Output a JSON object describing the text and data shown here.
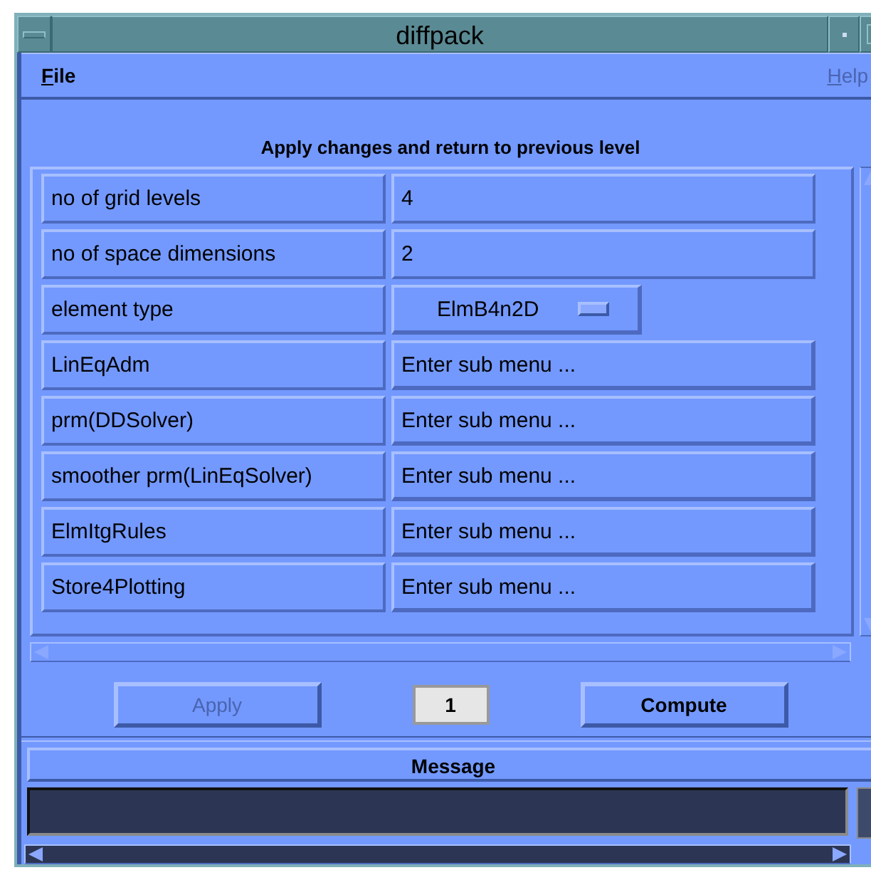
{
  "window": {
    "title": "diffpack"
  },
  "menu": [
    {
      "label": "File",
      "underline_first": true,
      "disabled": false
    },
    {
      "label": "Help",
      "underline_first": true,
      "disabled": true
    }
  ],
  "heading": "Apply changes and return to previous level",
  "parameters": [
    {
      "label": "no of grid levels",
      "kind": "field",
      "value": "4"
    },
    {
      "label": "no of space dimensions",
      "kind": "field",
      "value": "2"
    },
    {
      "label": "element type",
      "kind": "option",
      "value": "ElmB4n2D"
    },
    {
      "label": "LinEqAdm",
      "kind": "submenu",
      "value": "Enter sub menu ..."
    },
    {
      "label": "prm(DDSolver)",
      "kind": "submenu",
      "value": "Enter sub menu ..."
    },
    {
      "label": "smoother prm(LinEqSolver)",
      "kind": "submenu",
      "value": "Enter sub menu ..."
    },
    {
      "label": "ElmItgRules",
      "kind": "submenu",
      "value": "Enter sub menu ..."
    },
    {
      "label": "Store4Plotting",
      "kind": "submenu",
      "value": "Enter sub menu ..."
    }
  ],
  "buttons": [
    {
      "kind": "button",
      "label": "Apply",
      "disabled": true
    },
    {
      "kind": "counter",
      "label": "1"
    },
    {
      "kind": "button",
      "label": "Compute",
      "disabled": false
    }
  ],
  "message": {
    "title": "Message"
  }
}
